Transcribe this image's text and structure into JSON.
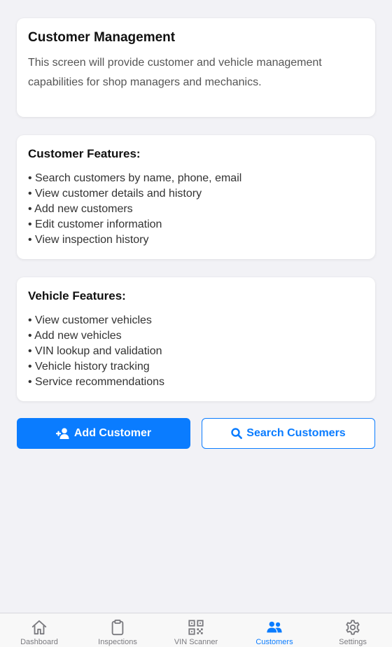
{
  "intro": {
    "title": "Customer Management",
    "description": "This screen will provide customer and vehicle management capabilities for shop managers and mechanics."
  },
  "customer_features": {
    "title": "Customer Features:",
    "items": [
      "• Search customers by name, phone, email",
      "• View customer details and history",
      "• Add new customers",
      "• Edit customer information",
      "• View inspection history"
    ]
  },
  "vehicle_features": {
    "title": "Vehicle Features:",
    "items": [
      "• View customer vehicles",
      "• Add new vehicles",
      "• VIN lookup and validation",
      "• Vehicle history tracking",
      "• Service recommendations"
    ]
  },
  "actions": {
    "add_label": "Add Customer",
    "add_icon": "user-plus-icon",
    "search_label": "Search Customers",
    "search_icon": "search-icon"
  },
  "tabbar": {
    "active": "Customers",
    "active_color": "#0a7cff",
    "inactive_color": "#7a7a7f",
    "tabs": [
      {
        "label": "Dashboard",
        "icon": "home-icon"
      },
      {
        "label": "Inspections",
        "icon": "clipboard-icon"
      },
      {
        "label": "VIN Scanner",
        "icon": "qr-code-icon"
      },
      {
        "label": "Customers",
        "icon": "users-icon"
      },
      {
        "label": "Settings",
        "icon": "gear-icon"
      }
    ]
  },
  "colors": {
    "accent": "#0a7cff",
    "background": "#f2f2f6",
    "card": "#ffffff"
  }
}
